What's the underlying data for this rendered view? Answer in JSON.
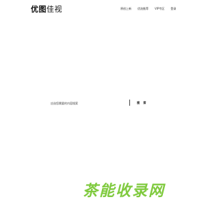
{
  "header": {
    "logo_part1": "优图",
    "logo_part2": "佳视"
  },
  "nav": {
    "items": [
      "原创上新",
      "优选推荐",
      "VIP专区",
      "登录"
    ]
  },
  "search": {
    "placeholder": "应选您需要的内容搜索",
    "button_label": "搜 索"
  },
  "watermark": {
    "text": "茶能收录网"
  }
}
